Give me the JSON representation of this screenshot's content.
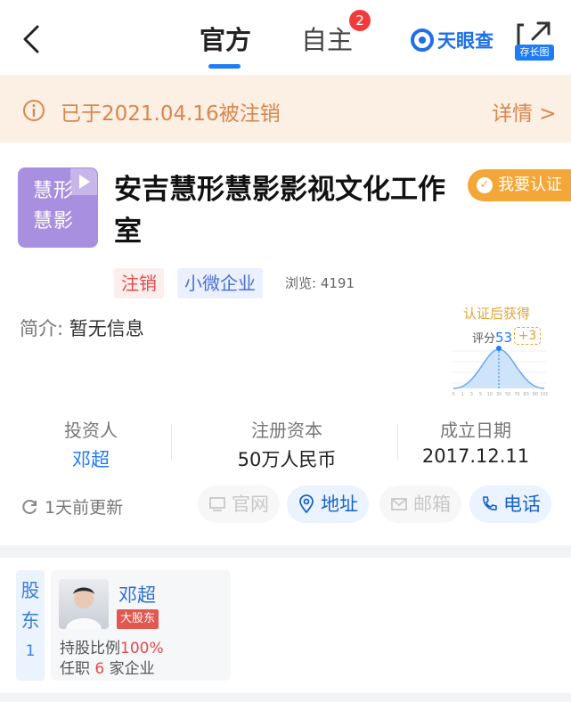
{
  "nav": {
    "tabs": [
      {
        "label": "官方"
      },
      {
        "label": "自主",
        "badge": "2"
      }
    ],
    "brand": "天眼查",
    "share_tag": "存长图"
  },
  "banner": {
    "text": "已于2021.04.16被注销",
    "link": "详情 >"
  },
  "company": {
    "logo_text_1": "慧形",
    "logo_text_2": "慧影",
    "name": "安吉慧形慧影影视文化工作室",
    "certify_label": "我要认证",
    "tags": [
      "注销",
      "小微企业"
    ],
    "views_label": "浏览: 4191",
    "intro_label": "简介:",
    "intro_value": "暂无信息"
  },
  "score": {
    "title": "认证后获得",
    "label": "评分",
    "value": "53",
    "plus": "+3",
    "axis_ticks": [
      "0",
      "1",
      "3",
      "5",
      "10",
      "30",
      "50",
      "70",
      "80",
      "90",
      "100"
    ]
  },
  "stats": [
    {
      "key": "投资人",
      "value": "邓超"
    },
    {
      "key": "注册资本",
      "value": "50万人民币"
    },
    {
      "key": "成立日期",
      "value": "2017.12.11"
    }
  ],
  "actions": {
    "updated": "1天前更新",
    "website": "官网",
    "address": "地址",
    "email": "邮箱",
    "phone": "电话"
  },
  "shareholders": {
    "label": "股东",
    "count": "1",
    "items": [
      {
        "name": "邓超",
        "badge": "大股东",
        "ratio_label": "持股比例",
        "ratio": "100%",
        "jobs_prefix": "任职",
        "jobs_count": "6",
        "jobs_suffix": "家企业"
      }
    ]
  },
  "colors": {
    "accent": "#1e7cf6",
    "banner_bg": "#fcefe4",
    "banner_text": "#d9874c",
    "certify": "#f4a739",
    "tag_red": "#e24a4a",
    "logo_bg": "#a98fdf"
  }
}
